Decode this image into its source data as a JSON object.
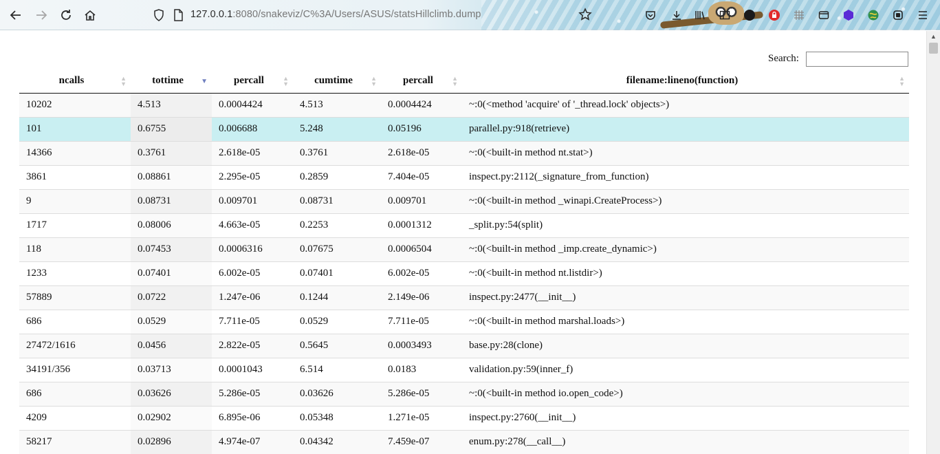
{
  "browser": {
    "url_host": "127.0.0.1",
    "url_rest": ":8080/snakeviz/C%3A/Users/ASUS/statsHillclimb.dump"
  },
  "search": {
    "label": "Search:",
    "value": ""
  },
  "table": {
    "columns": [
      "ncalls",
      "tottime",
      "percall",
      "cumtime",
      "percall",
      "filename:lineno(function)"
    ],
    "sorted_column": "tottime",
    "sort_direction": "descending",
    "rows": [
      [
        "10202",
        "4.513",
        "0.0004424",
        "4.513",
        "0.0004424",
        "~:0(<method 'acquire' of '_thread.lock' objects>)"
      ],
      [
        "101",
        "0.6755",
        "0.006688",
        "5.248",
        "0.05196",
        "parallel.py:918(retrieve)"
      ],
      [
        "14366",
        "0.3761",
        "2.618e-05",
        "0.3761",
        "2.618e-05",
        "~:0(<built-in method nt.stat>)"
      ],
      [
        "3861",
        "0.08861",
        "2.295e-05",
        "0.2859",
        "7.404e-05",
        "inspect.py:2112(_signature_from_function)"
      ],
      [
        "9",
        "0.08731",
        "0.009701",
        "0.08731",
        "0.009701",
        "~:0(<built-in method _winapi.CreateProcess>)"
      ],
      [
        "1717",
        "0.08006",
        "4.663e-05",
        "0.2253",
        "0.0001312",
        "_split.py:54(split)"
      ],
      [
        "118",
        "0.07453",
        "0.0006316",
        "0.07675",
        "0.0006504",
        "~:0(<built-in method _imp.create_dynamic>)"
      ],
      [
        "1233",
        "0.07401",
        "6.002e-05",
        "0.07401",
        "6.002e-05",
        "~:0(<built-in method nt.listdir>)"
      ],
      [
        "57889",
        "0.0722",
        "1.247e-06",
        "0.1244",
        "2.149e-06",
        "inspect.py:2477(__init__)"
      ],
      [
        "686",
        "0.0529",
        "7.711e-05",
        "0.0529",
        "7.711e-05",
        "~:0(<built-in method marshal.loads>)"
      ],
      [
        "27472/1616",
        "0.0456",
        "2.822e-05",
        "0.5645",
        "0.0003493",
        "base.py:28(clone)"
      ],
      [
        "34191/356",
        "0.03713",
        "0.0001043",
        "6.514",
        "0.0183",
        "validation.py:59(inner_f)"
      ],
      [
        "686",
        "0.03626",
        "5.286e-05",
        "0.03626",
        "5.286e-05",
        "~:0(<built-in method io.open_code>)"
      ],
      [
        "4209",
        "0.02902",
        "6.895e-06",
        "0.05348",
        "1.271e-05",
        "inspect.py:2760(__init__)"
      ],
      [
        "58217",
        "0.02896",
        "4.974e-07",
        "0.04342",
        "7.459e-07",
        "enum.py:278(__call__)"
      ]
    ],
    "highlight_row_index": 1,
    "highlight_color": "#c9eff2"
  }
}
